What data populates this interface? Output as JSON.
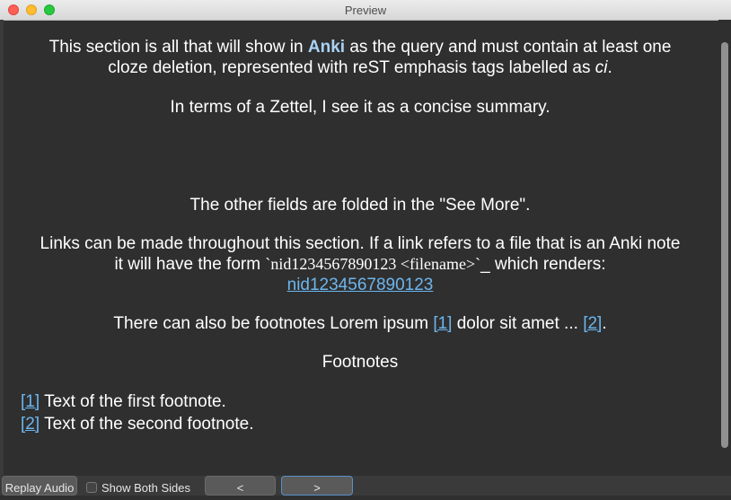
{
  "window": {
    "title": "Preview"
  },
  "content": {
    "p1_before": "This section is all that will show in ",
    "p1_bold": "Anki",
    "p1_after": " as the query and must contain at least one",
    "p1_line2_before": "cloze deletion, represented with reST emphasis tags labelled as ",
    "p1_line2_italic": "ci",
    "p1_line2_after": ".",
    "p2": "In terms of a Zettel, I see it as a concise summary.",
    "p3": "The other fields are folded in the \"See More\".",
    "p4_line1": "Links can be made throughout this section. If a link refers to a file that is an Anki note",
    "p4_line2_before": "it will have the form ",
    "p4_line2_code": "`nid1234567890123 <filename>`",
    "p4_line2_after": "_ which renders:",
    "p4_link": "nid1234567890123",
    "p5_before": "There can also be footnotes Lorem ipsum ",
    "p5_ref1": "[1]",
    "p5_middle": " dolor sit amet ... ",
    "p5_ref2": "[2]",
    "p5_after": ".",
    "footnotes_heading": "Footnotes",
    "footnotes": [
      {
        "ref": "[1]",
        "text": "Text of the first footnote."
      },
      {
        "ref": "[2]",
        "text": "Text of the second footnote."
      }
    ]
  },
  "bottom_bar": {
    "replay_audio": "Replay Audio",
    "show_both_sides": "Show Both Sides",
    "show_both_sides_checked": false,
    "prev_label": "<",
    "next_label": ">"
  }
}
